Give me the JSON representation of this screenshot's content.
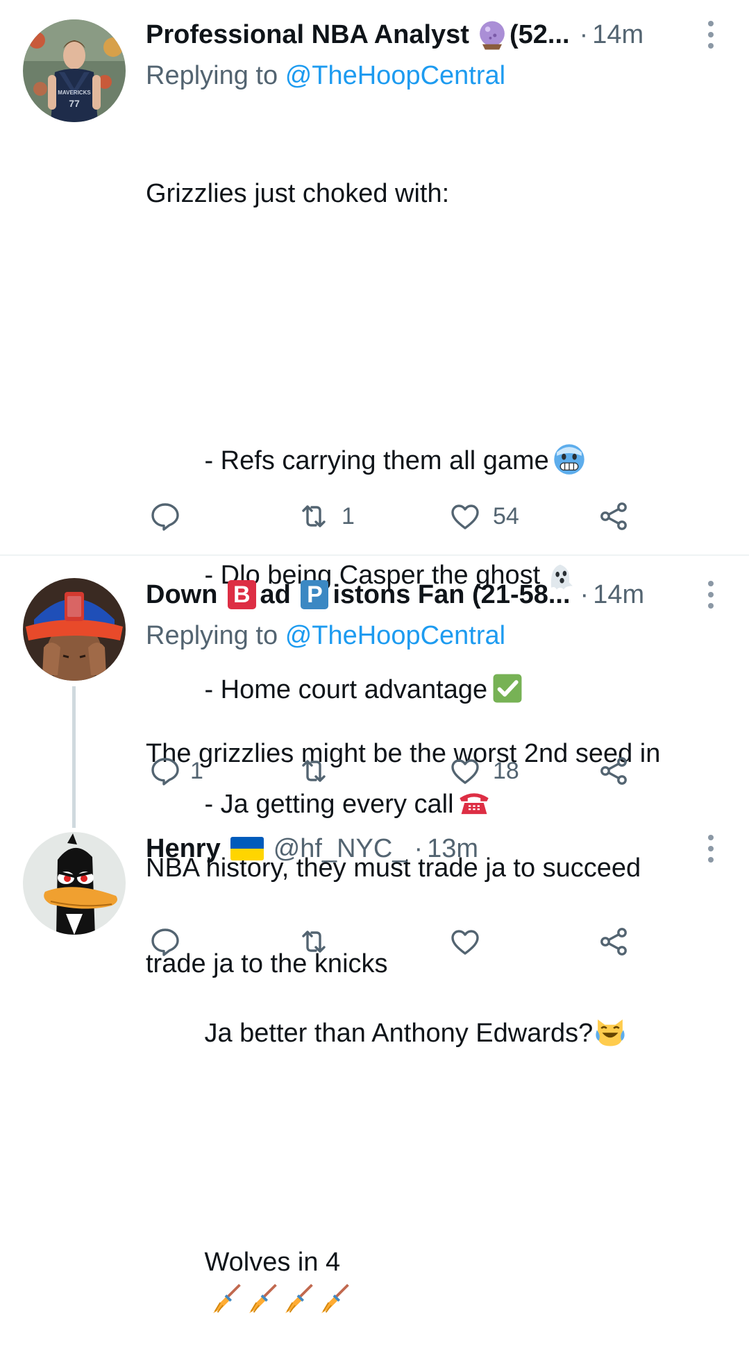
{
  "tweets": [
    {
      "name": "Professional NBA Analyst",
      "name_suffix": "(52...",
      "time": "14m",
      "replying_prefix": "Replying to",
      "replying_handle": "@TheHoopCentral",
      "lines": [
        "Grizzlies just choked with:",
        "",
        "- Refs carrying them all game",
        "- Dlo being Casper the ghost",
        "- Home court advantage",
        "- Ja getting every call",
        "",
        "Ja better than Anthony Edwards?",
        "",
        "Wolves in 4"
      ],
      "reply_count": "",
      "retweet_count": "1",
      "like_count": "54",
      "avatar_jersey_text": "MAVERICKS",
      "avatar_jersey_number": "77",
      "icons": {
        "name_emoji": "crystal-ball-icon",
        "line_emojis": [
          "cold-face-icon",
          "ghost-icon",
          "check-mark-icon",
          "telephone-icon",
          "laughing-cat-icon",
          "broom-icon"
        ]
      }
    },
    {
      "name_part1": "Down ",
      "badge_b": "B",
      "name_part2": "ad ",
      "badge_p": "P",
      "name_part3": "istons Fan (21-58...",
      "time": "14m",
      "replying_prefix": "Replying to",
      "replying_handle": "@TheHoopCentral",
      "lines": [
        "The grizzlies might be the worst 2nd seed in",
        "NBA history, they must trade ja to succeed"
      ],
      "reply_count": "1",
      "retweet_count": "",
      "like_count": "18",
      "badge_colors": {
        "b": "#dd2e44",
        "p": "#3b88c3"
      }
    },
    {
      "name": "Henry",
      "handle": "@hf_NYC_",
      "time": "13m",
      "lines": [
        "trade ja to the knicks"
      ],
      "reply_count": "",
      "retweet_count": "",
      "like_count": "",
      "flag_colors": {
        "top": "#005bbb",
        "bottom": "#ffd500"
      }
    }
  ],
  "colors": {
    "link": "#1d9bf0",
    "muted": "#536471",
    "text": "#0f1419",
    "divider": "#eff3f4",
    "thread_line": "#cfd9de"
  }
}
